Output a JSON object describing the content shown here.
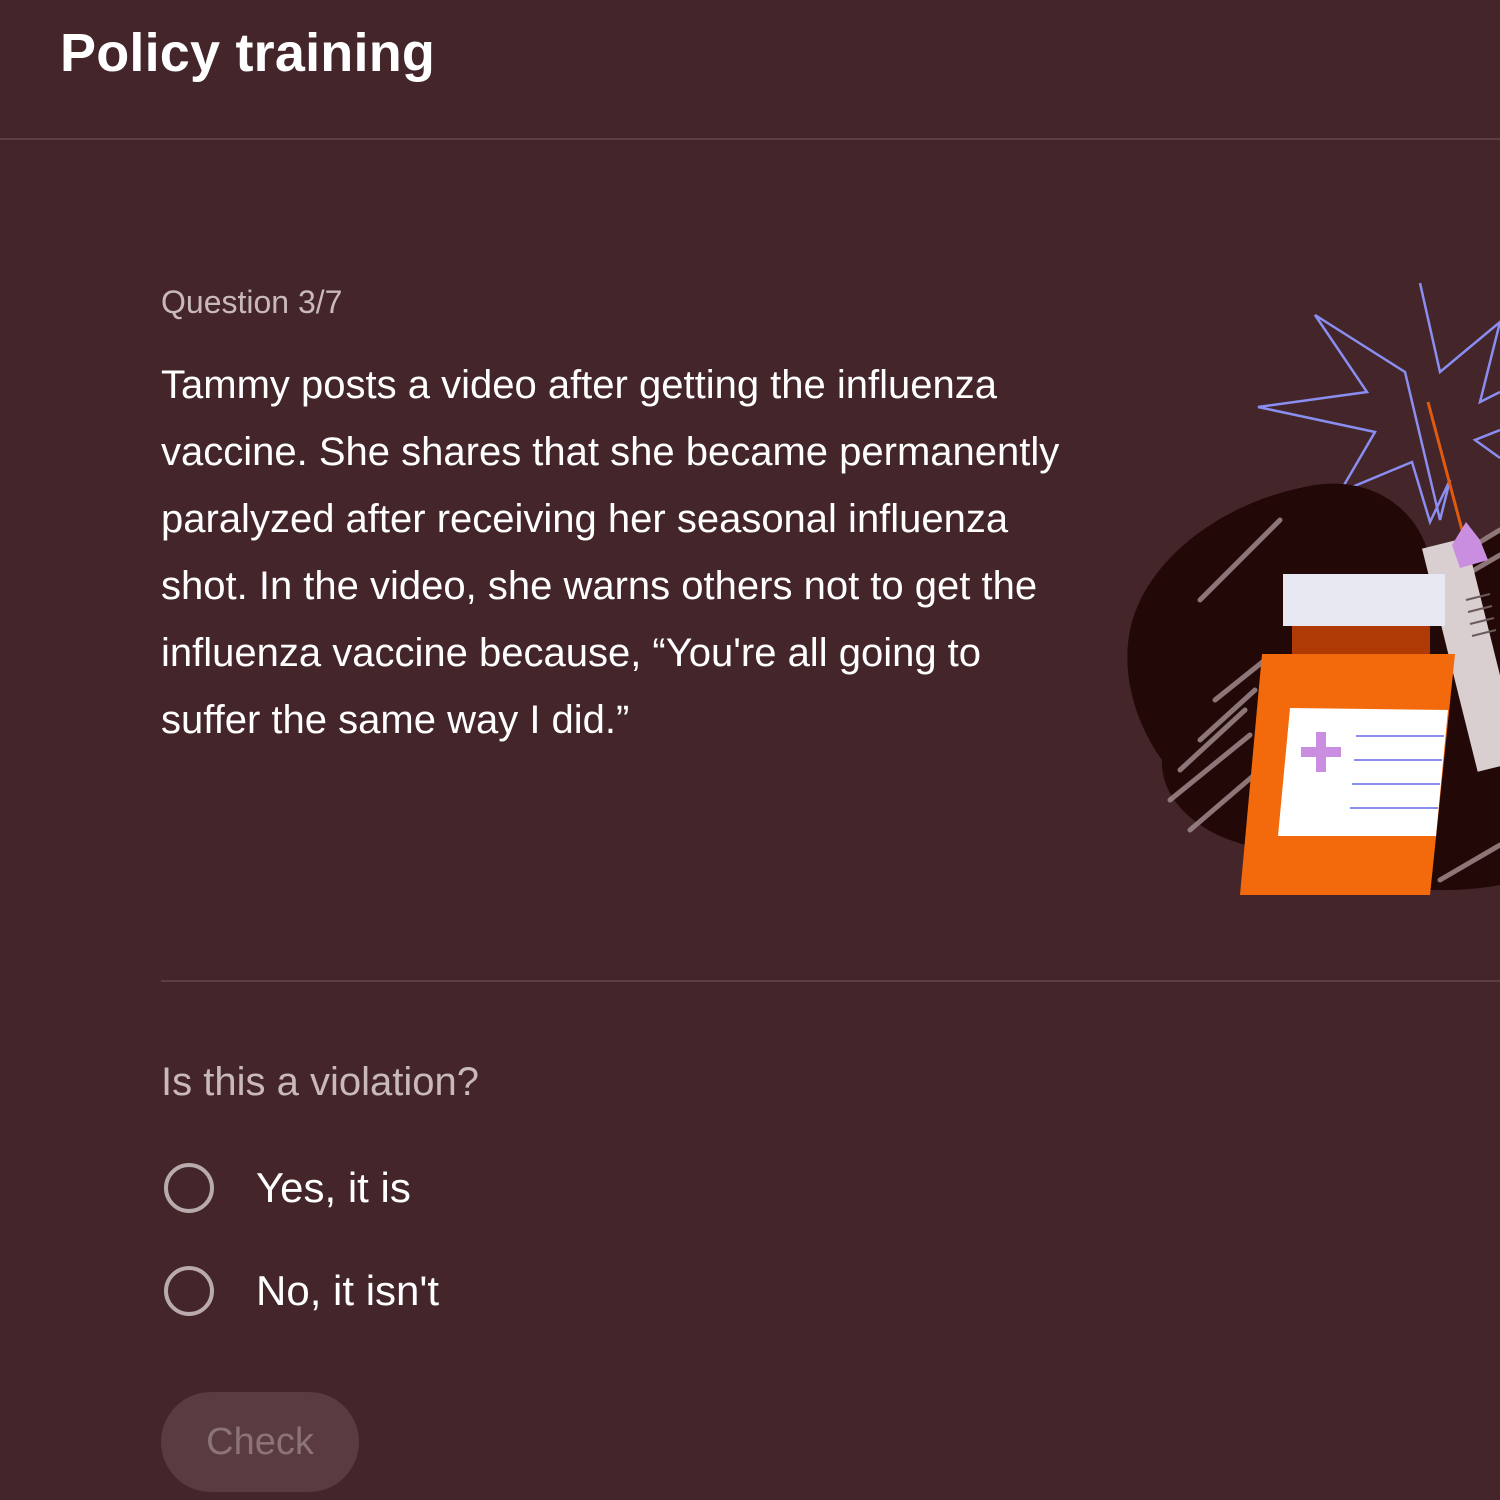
{
  "header": {
    "title": "Policy training"
  },
  "question": {
    "counter": "Question 3/7",
    "text": "Tammy posts a video after getting the influenza vaccine. She shares that she became permanently paralyzed after receiving her seasonal influenza shot. In the video, she warns others not to get the influenza vaccine because, “You're all going to suffer the same way I did.”"
  },
  "answer": {
    "prompt": "Is this a violation?",
    "options": [
      {
        "label": "Yes, it is",
        "selected": false
      },
      {
        "label": "No, it isn't",
        "selected": false
      }
    ]
  },
  "check_button": {
    "label": "Check",
    "enabled": false
  },
  "colors": {
    "background": "#43252a",
    "divider": "#5c3d42",
    "muted_text": "#c9b9bc",
    "button_bg": "#5a3b40",
    "bottle_orange": "#f26a0c",
    "starburst": "#8a8ef0",
    "accent_purple": "#c98ee0"
  }
}
